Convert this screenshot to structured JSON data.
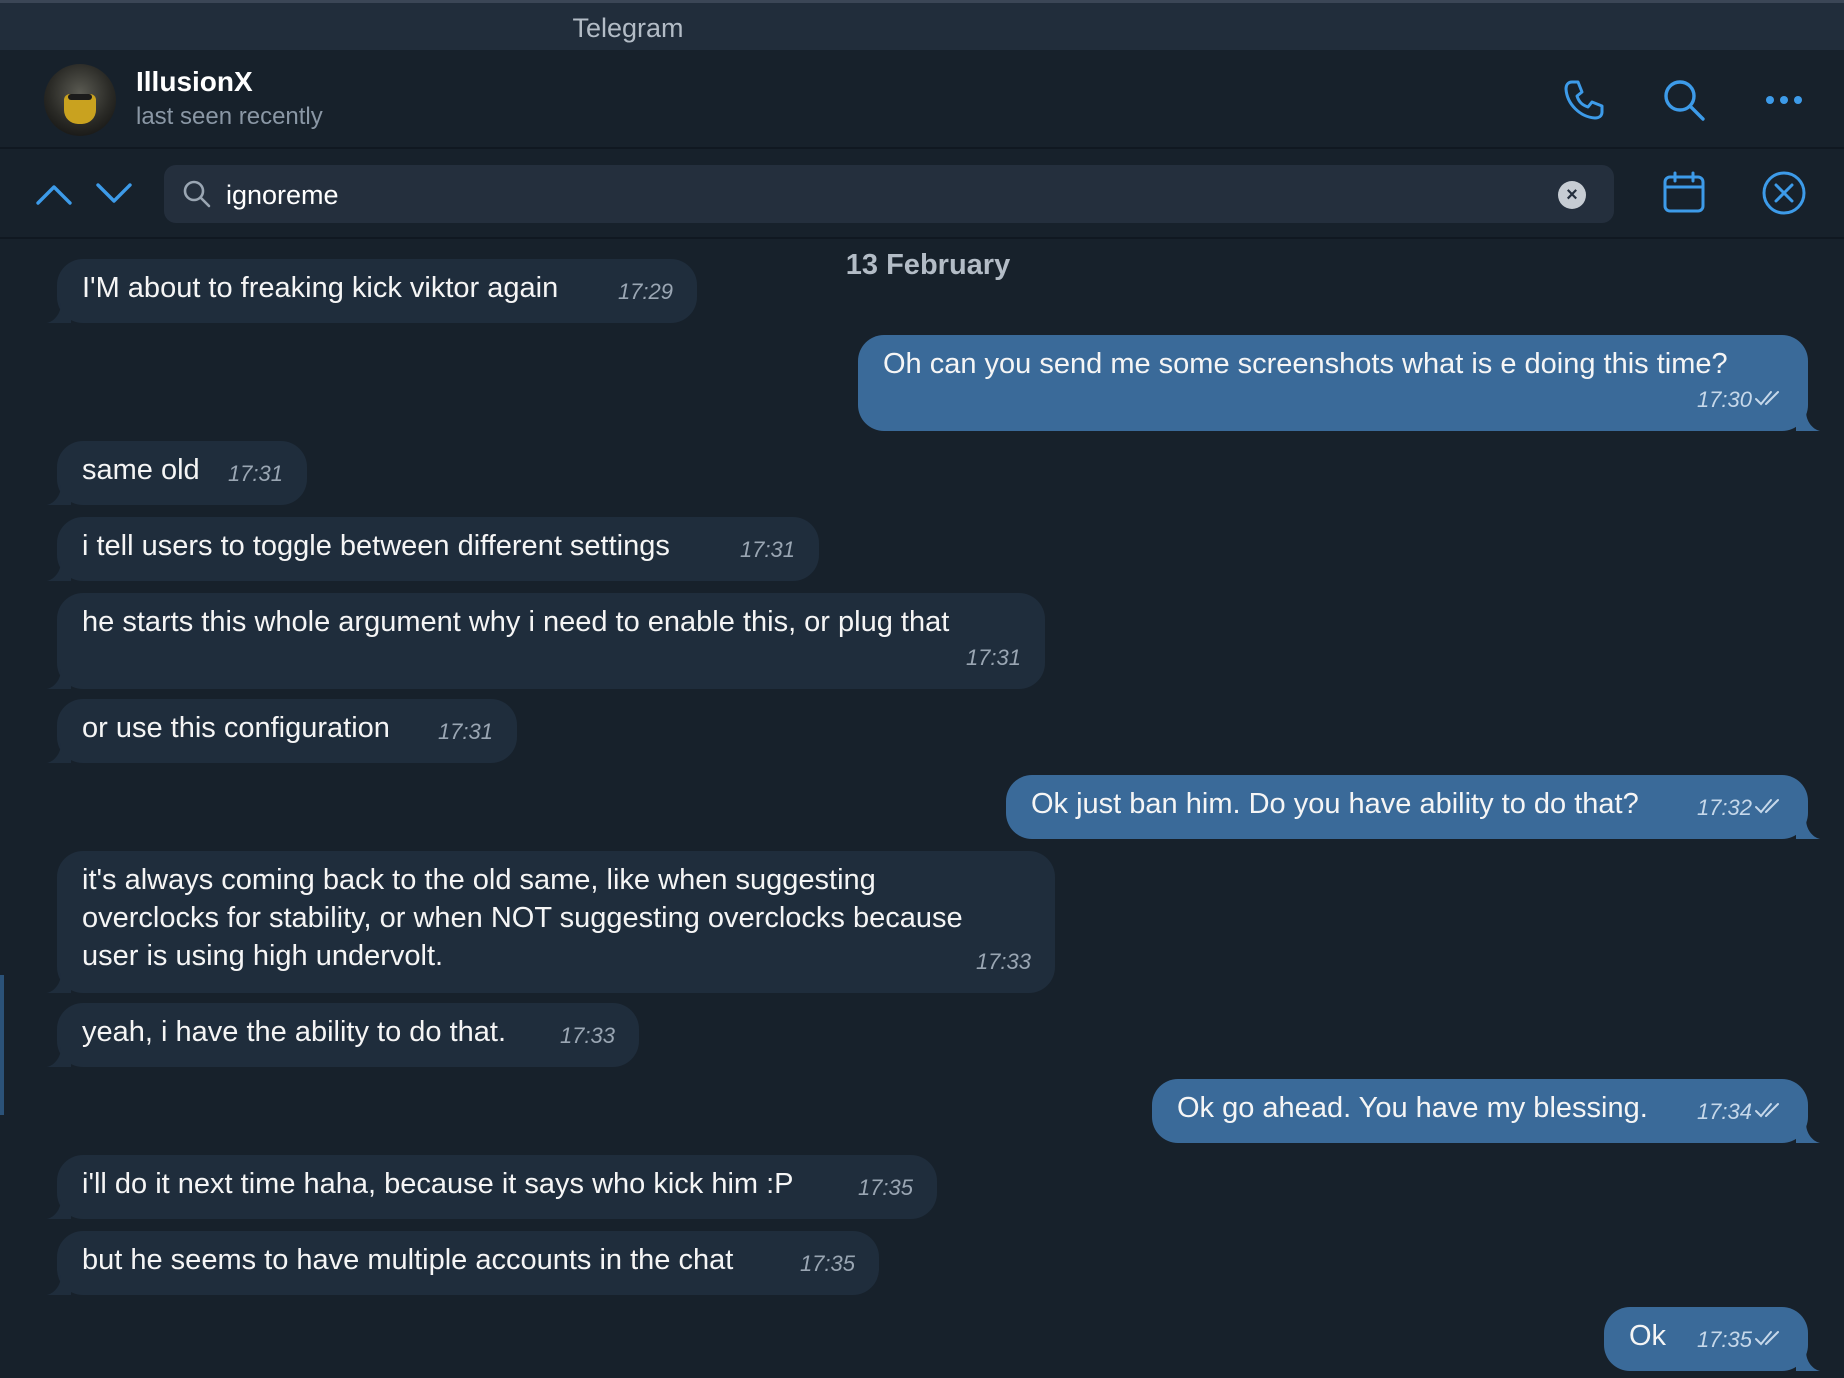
{
  "window": {
    "title": "Telegram"
  },
  "contact": {
    "name": "IllusionX",
    "status": "last seen recently"
  },
  "header_icons": [
    "phone-icon",
    "search-icon",
    "more-icon"
  ],
  "search": {
    "query": "ignoreme",
    "placeholder": "Search"
  },
  "search_icons": [
    "chevron-up-icon",
    "chevron-down-icon",
    "calendar-icon",
    "close-circle-icon"
  ],
  "date_separator": "13 February",
  "messages": [
    {
      "dir": "in",
      "text": "I'M about to freaking kick viktor again",
      "time": "17:29"
    },
    {
      "dir": "out",
      "text": "Oh can you send me some screenshots what is e doing this time?",
      "time": "17:30"
    },
    {
      "dir": "in",
      "text": "same old",
      "time": "17:31"
    },
    {
      "dir": "in",
      "text": "i tell users to toggle between different settings",
      "time": "17:31"
    },
    {
      "dir": "in",
      "text": "he starts this whole argument why i need to enable this, or plug that",
      "time": "17:31"
    },
    {
      "dir": "in",
      "text": "or use this configuration",
      "time": "17:31"
    },
    {
      "dir": "out",
      "text": "Ok just ban him. Do you have ability to do that?",
      "time": "17:32"
    },
    {
      "dir": "in",
      "text": "it's always coming back to the old same, like when suggesting overclocks for stability, or when NOT suggesting overclocks because user is using high undervolt.",
      "time": "17:33"
    },
    {
      "dir": "in",
      "text": "yeah, i have the ability to do that.",
      "time": "17:33"
    },
    {
      "dir": "out",
      "text": "Ok go ahead. You have my blessing.",
      "time": "17:34"
    },
    {
      "dir": "in",
      "text": "i'll do it next time haha, because it says who kick him :P",
      "time": "17:35"
    },
    {
      "dir": "in",
      "text": "but he seems to have multiple accounts in the chat",
      "time": "17:35"
    },
    {
      "dir": "out",
      "text": "Ok",
      "time": "17:35"
    }
  ],
  "colors": {
    "background": "#17212b",
    "incoming": "#1f2d3c",
    "outgoing": "#3a6a99",
    "accent": "#3d9be9"
  }
}
